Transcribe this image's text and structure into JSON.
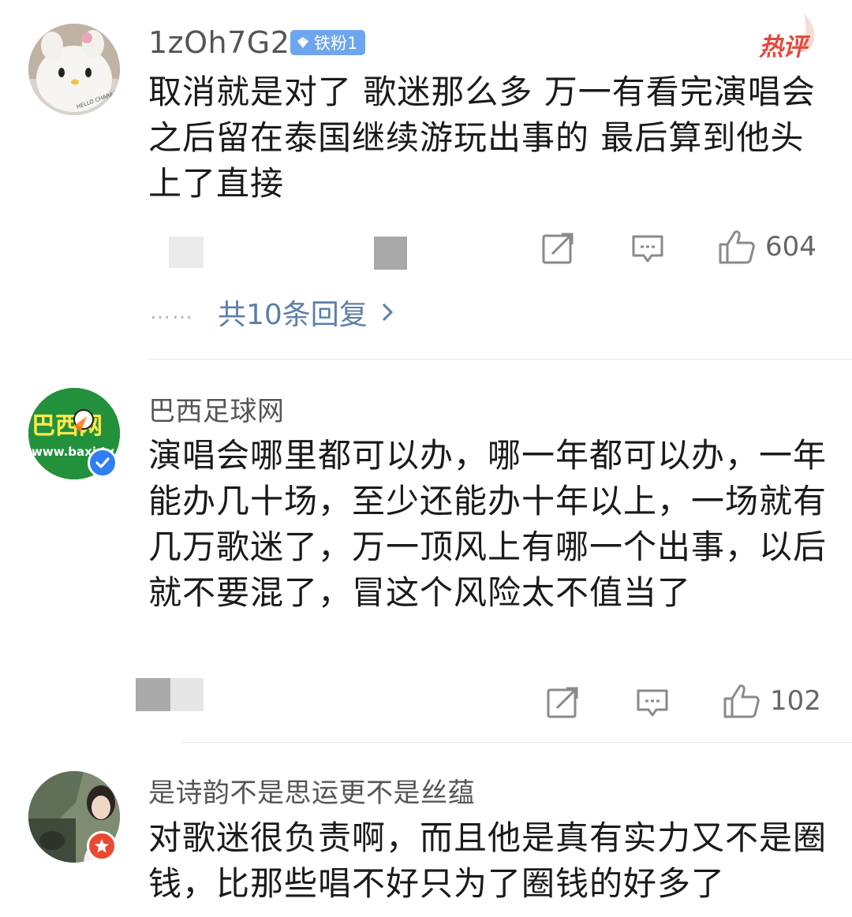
{
  "comments": [
    {
      "username": "1zOh7G2",
      "fan_badge": "铁粉1",
      "hot_tag": "热评",
      "text": "取消就是对了  歌迷那么多  万一有看完演唱会之后留在泰国继续游玩出事的  最后算到他头上了直接",
      "like_count": "604",
      "replies_label": "共10条回复",
      "avatar_icon": "hello-kitty-plush-avatar"
    },
    {
      "username": "巴西足球网",
      "text": "演唱会哪里都可以办，哪一年都可以办，一年能办几十场，至少还能办十年以上，一场就有几万歌迷了，万一顶风上有哪一个出事，以后就不要混了，冒这个风险太不值当了",
      "like_count": "102",
      "avatar_text": "巴西网",
      "avatar_url_text": "www.baxi.tv",
      "verified_icon": "blue-verified-check-icon"
    },
    {
      "username": "是诗韵不是思运更不是丝蕴",
      "text": "对歌迷很负责啊，而且他是真有实力又不是圈钱，比那些唱不好只为了圈钱的好多了",
      "avatar_icon": "person-outdoor-photo-avatar",
      "badge_icon": "red-star-badge-icon"
    }
  ],
  "colors": {
    "username": "#555555",
    "text": "#1a1a1a",
    "fan_badge_bg": "#6ea6ee",
    "hot_tag": "#e4493b",
    "reply_link": "#5d7fa8",
    "icon_gray": "#888888",
    "divider": "#e6e6e6"
  }
}
